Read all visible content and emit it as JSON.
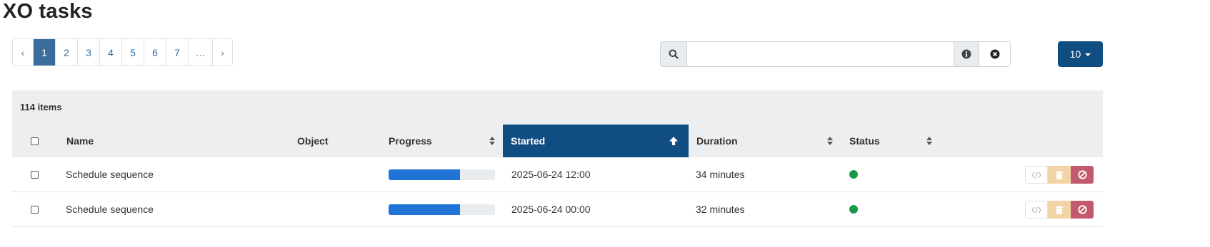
{
  "page": {
    "title": "XO tasks"
  },
  "pagination": {
    "prev_label": "‹",
    "next_label": "›",
    "pages": [
      "1",
      "2",
      "3",
      "4",
      "5",
      "6",
      "7",
      "…"
    ],
    "active_page": "1"
  },
  "search": {
    "value": "",
    "placeholder": "",
    "search_icon": "search-icon",
    "info_icon": "info-icon",
    "clear_icon": "close-icon"
  },
  "page_size": {
    "label": "10"
  },
  "table": {
    "item_count": "114 items",
    "columns": {
      "name": "Name",
      "object": "Object",
      "progress": "Progress",
      "started": "Started",
      "duration": "Duration",
      "status": "Status"
    },
    "sorted_column": "started",
    "sort_direction": "ascending",
    "rows": [
      {
        "name": "Schedule sequence",
        "object": "",
        "progress": 0.67,
        "started": "2025-06-24 12:00",
        "duration": "34 minutes",
        "status_color": "#1a9a48"
      },
      {
        "name": "Schedule sequence",
        "object": "",
        "progress": 0.67,
        "started": "2025-06-24 00:00",
        "duration": "32 minutes",
        "status_color": "#1a9a48"
      }
    ]
  },
  "colors": {
    "accent": "#104e82",
    "active_page": "#3a6d9c",
    "progress": "#1f74d6",
    "status_ok": "#1a9a48"
  }
}
